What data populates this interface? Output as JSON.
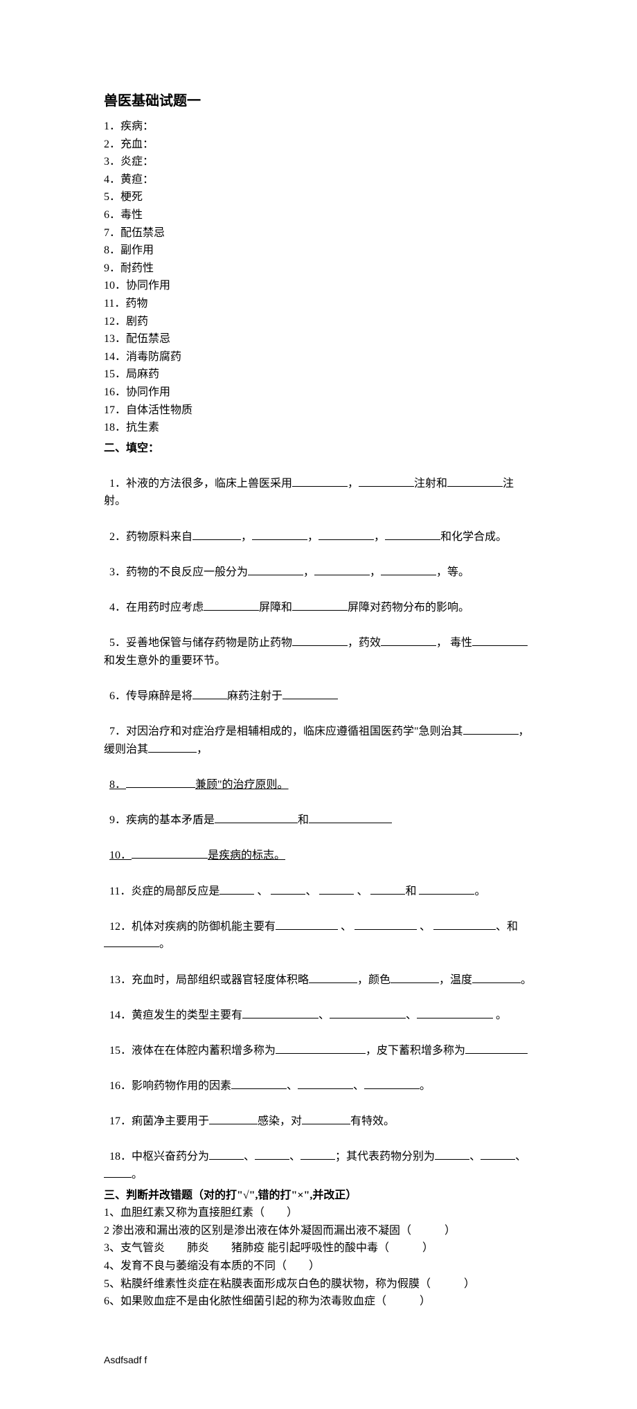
{
  "title": "兽医基础试题一",
  "section1_items": [
    "1．疾病：",
    "2．充血：",
    "3．炎症：",
    "4．黄疸：",
    "5．梗死",
    "6．毒性",
    "7．配伍禁忌",
    "8．副作用",
    "9．耐药性",
    "10．协同作用",
    "11．药物",
    "12．剧药",
    "13．配伍禁忌",
    "14．消毒防腐药",
    "15．局麻药",
    "16．协同作用",
    "17．自体活性物质",
    "18．抗生素"
  ],
  "section2_heading": "二、填空：",
  "q1_a": "1．补液的方法很多，临床上兽医采用",
  "q1_b": "，",
  "q1_c": "注射和",
  "q1_d": "注射。",
  "q2_a": "2．药物原料来自",
  "q2_b": "，",
  "q2_c": "，",
  "q2_d": "，",
  "q2_e": "和化学合成。",
  "q3_a": "3．药物的不良反应一般分为",
  "q3_b": "，",
  "q3_c": "，",
  "q3_d": "，等。",
  "q4_a": "4．在用药时应考虑",
  "q4_b": "屏障和",
  "q4_c": "屏障对药物分布的影响。",
  "q5_a": "5．妥善地保管与储存药物是防止药物",
  "q5_b": "，药效",
  "q5_c": "， 毒性",
  "q5_d": "和发生意外的重要环节。",
  "q6_a": "6．传导麻醉是将",
  "q6_b": "麻药注射于",
  "q7_a": "7．对因治疗和对症治疗是相辅相成的，临床应遵循祖国医药学\"急则治其",
  "q7_b": "，缓则治其",
  "q7_c": "，",
  "q8_a": "8．",
  "q8_b": "兼顾\"的治疗原则。",
  "q9_a": "9．疾病的基本矛盾是",
  "q9_b": "和",
  "q10_a": "10．",
  "q10_b": "是疾病的标志。",
  "q11_a": "11．炎症的局部反应是",
  "q11_b": " 、 ",
  "q11_c": "、 ",
  "q11_d": " 、 ",
  "q11_e": "和 ",
  "q11_f": "。",
  "q12_a": "12．机体对疾病的防御机能主要有",
  "q12_b": " 、 ",
  "q12_c": " 、 ",
  "q12_d": "、和",
  "q12_e": "。",
  "q13_a": "13．充血时，局部组织或器官轻度体积略",
  "q13_b": "，颜色",
  "q13_c": "，温度",
  "q13_d": "。",
  "q14_a": "14．黄疸发生的类型主要有",
  "q14_b": "、",
  "q14_c": "、",
  "q14_d": " 。",
  "q15_a": "15．液体在在体腔内蓄积增多称为",
  "q15_b": "，皮下蓄积增多称为",
  "q16_a": "16．影响药物作用的因素",
  "q16_b": "、",
  "q16_c": "、",
  "q16_d": "。",
  "q17_a": "17．痢菌净主要用于",
  "q17_b": "感染，对",
  "q17_c": "有特效。",
  "q18_a": "18．中枢兴奋药分为",
  "q18_b": "、",
  "q18_c": "、",
  "q18_d": "；其代表药物分别为",
  "q18_e": "、",
  "q18_f": "、",
  "q18_g": "。",
  "section3_heading": "三、判断并改错题（对的打\"√\",错的打\"×\",并改正）",
  "s3_items": [
    "1、血胆红素又称为直接胆红素（　　）",
    "2 渗出液和漏出液的区别是渗出液在体外凝固而漏出液不凝固（　　　）",
    "3、支气管炎　　肺炎　　猪肺疫 能引起呼吸性的酸中毒（　　　）",
    "4、发育不良与萎缩没有本质的不同（　　）",
    "5、粘膜纤维素性炎症在粘膜表面形成灰白色的膜状物，称为假膜（　　　）",
    "6、如果败血症不是由化脓性细菌引起的称为浓毒败血症（　　　）"
  ],
  "footer": "Asdfsadf f"
}
